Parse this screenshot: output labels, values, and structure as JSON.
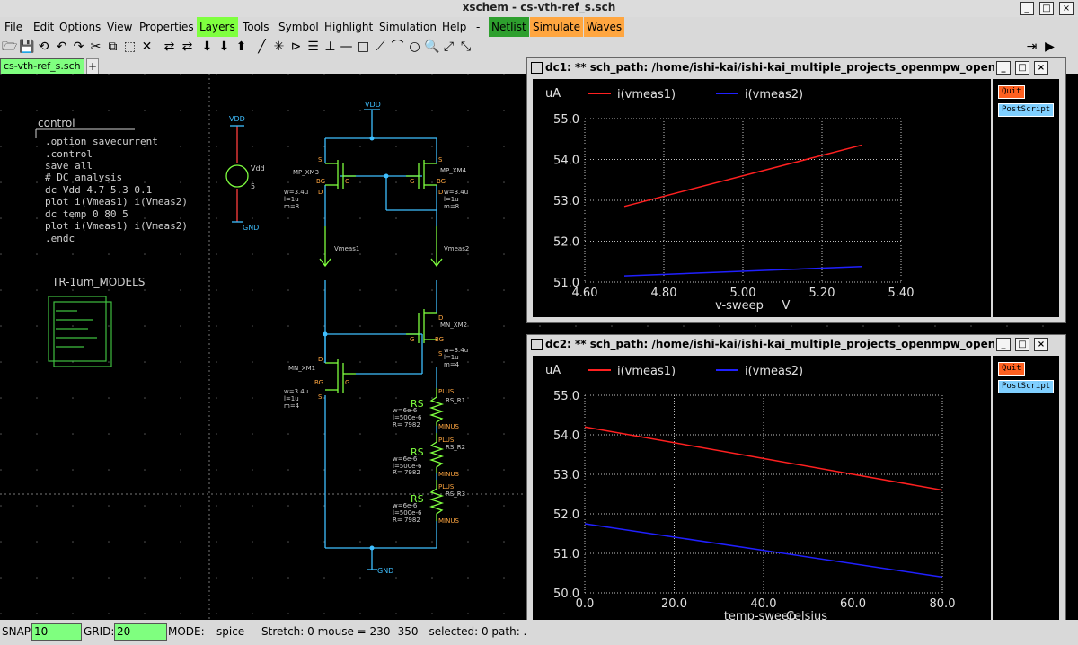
{
  "window": {
    "title": "xschem - cs-vth-ref_s.sch",
    "buttons": [
      "_",
      "□",
      "×"
    ]
  },
  "menubar": {
    "items": [
      "File",
      "Edit",
      "Options",
      "View",
      "Properties",
      "Layers",
      "Tools",
      "Symbol",
      "Highlight",
      "Simulation",
      "Help",
      "-",
      "Netlist",
      "Simulate",
      "Waves"
    ],
    "colors": {
      "Layers": "#7fff3f",
      "Netlist": "#2e9f2e",
      "Simulate": "#ffa640",
      "Waves": "#ffa640"
    }
  },
  "toolbar": {
    "icons": [
      "open-icon",
      "save-icon",
      "reload-icon",
      "undo-icon",
      "redo-icon",
      "cut-icon",
      "copy-icon",
      "delete-icon",
      "select-icon",
      "move-icon",
      "place-icon",
      "push-icon",
      "pop-icon",
      "wire-icon",
      "line-icon",
      "rect-icon",
      "arc-icon",
      "circle-icon",
      "zoom-icon",
      "fullscreen-icon"
    ],
    "glyphs": [
      "🗁",
      "💾",
      "⟲",
      "↶",
      "↷",
      "✂",
      "⧉",
      "✕",
      "⬚",
      "⇄",
      "⬇",
      "⬇",
      "⬆",
      "╱",
      "✳",
      "⊳",
      "☰",
      "⊥",
      "—",
      "□",
      "⟋",
      "⌒",
      "○",
      "🔍",
      "⤢",
      "⤡",
      "⇥",
      "▶"
    ]
  },
  "tab": {
    "name": "cs-vth-ref_s.sch",
    "add": "+"
  },
  "schematic": {
    "control_title": "control",
    "control_lines": [
      ".option savecurrent",
      ".control",
      "save all",
      "# DC analysis",
      "dc Vdd  4.7 5.3 0.1",
      "plot i(Vmeas1) i(Vmeas2)",
      "dc temp 0 80 5",
      "plot i(Vmeas1) i(Vmeas2)",
      ".endc"
    ],
    "models_label": "TR-1um_MODELS",
    "labels": {
      "vdd_top": "VDD",
      "vdd_src": "VDD",
      "vdd_name": "Vdd",
      "vdd_value": "5",
      "gnd1": "GND",
      "gnd2": "GND",
      "mp3": "MP_XM3",
      "mp4": "MP_XM4",
      "mn2": "MN_XM2",
      "mn1": "MN_XM1",
      "mp3_params": [
        "w=3.4u",
        "l=1u",
        "m=8"
      ],
      "mp4_params": [
        "w=3.4u",
        "l=1u",
        "m=8"
      ],
      "mn2_params": [
        "w=3.4u",
        "l=1u",
        "m=4"
      ],
      "mn1_params": [
        "w=3.4u",
        "l=1u",
        "m=4"
      ],
      "vmeas1": "Vmeas1",
      "vmeas2": "Vmeas2",
      "rs1": "RS_R1",
      "rs2": "RS_R2",
      "rs3": "RS_R3",
      "rs_params": [
        "w=6e-6",
        "l=500e-6",
        "R= 7982"
      ],
      "plus": "PLUS",
      "minus": "MINUS",
      "rs": "RS",
      "pins": {
        "s": "S",
        "d": "D",
        "g": "G",
        "bg": "BG"
      }
    }
  },
  "status": {
    "snap_label": "SNAP:",
    "snap": "10",
    "grid_label": "GRID:",
    "grid": "20",
    "mode_label": "MODE:",
    "mode": "spice",
    "info": "Stretch: 0  mouse = 230 -350 - selected: 0 path: ."
  },
  "popups": [
    {
      "title": "dc1: ** sch_path: /home/ishi-kai/ishi-kai_multiple_projects_openmpw_opens...",
      "quit": "Quit",
      "postscript": "PostScript"
    },
    {
      "title": "dc2: ** sch_path: /home/ishi-kai/ishi-kai_multiple_projects_openmpw_opens...",
      "quit": "Quit",
      "postscript": "PostScript"
    }
  ],
  "chart_data": [
    {
      "type": "line",
      "ylabel": "uA",
      "xlabel": "v-sweep",
      "xunit": "V",
      "xlim": [
        4.6,
        5.4
      ],
      "ylim": [
        51.0,
        55.0
      ],
      "xticks": [
        "4.60",
        "4.80",
        "5.00",
        "5.20",
        "5.40"
      ],
      "yticks": [
        "51.0",
        "52.0",
        "53.0",
        "54.0",
        "55.0"
      ],
      "grid": true,
      "legend": "top",
      "series": [
        {
          "name": "i(vmeas1)",
          "color": "#ff2020",
          "x": [
            4.7,
            5.3
          ],
          "y": [
            52.85,
            54.35
          ]
        },
        {
          "name": "i(vmeas2)",
          "color": "#2020ff",
          "x": [
            4.7,
            5.3
          ],
          "y": [
            51.15,
            51.38
          ]
        }
      ]
    },
    {
      "type": "line",
      "ylabel": "uA",
      "xlabel": "temp-sweep",
      "xunit": "Celsius",
      "xlim": [
        0,
        80
      ],
      "ylim": [
        50.0,
        55.0
      ],
      "xticks": [
        "0.0",
        "20.0",
        "40.0",
        "60.0",
        "80.0"
      ],
      "yticks": [
        "50.0",
        "51.0",
        "52.0",
        "53.0",
        "54.0",
        "55.0"
      ],
      "grid": true,
      "legend": "top",
      "series": [
        {
          "name": "i(vmeas1)",
          "color": "#ff2020",
          "x": [
            0,
            80
          ],
          "y": [
            54.2,
            52.6
          ]
        },
        {
          "name": "i(vmeas2)",
          "color": "#2020ff",
          "x": [
            0,
            80
          ],
          "y": [
            51.75,
            50.4
          ]
        }
      ]
    }
  ]
}
